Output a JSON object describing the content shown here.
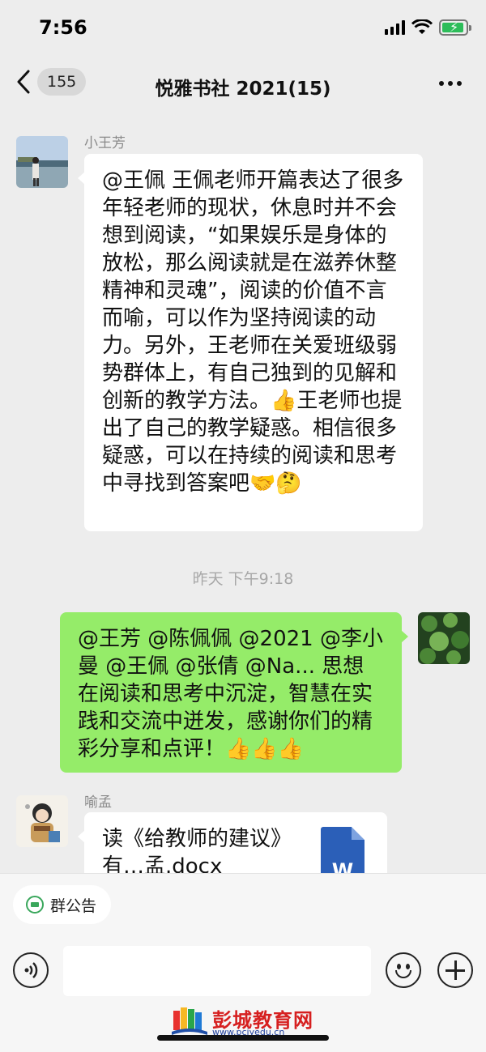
{
  "status_bar": {
    "time": "7:56"
  },
  "nav": {
    "unread_count": "155",
    "title": "悦雅书社 2021(15)"
  },
  "messages": [
    {
      "sender": "小王芳",
      "text": "@王佩 王佩老师开篇表达了很多年轻老师的现状，休息时并不会想到阅读，“如果娱乐是身体的放松，那么阅读就是在滋养休整精神和灵魂”，阅读的价值不言而喻，可以作为坚持阅读的动力。另外，王老师在关爱班级弱势群体上，有自己独到的见解和创新的教学方法。👍王老师也提出了自己的教学疑惑。相信很多疑惑，可以在持续的阅读和思考中寻找到答案吧🤝🤔"
    },
    {
      "timestamp": "昨天 下午9:18"
    },
    {
      "sender": "me",
      "text": "@王芳 @陈佩佩 @2021 @李小曼 @王佩 @张倩 @Na... 思想在阅读和思考中沉淀，智慧在实践和交流中迸发，感谢你们的精彩分享和点评！👍👍👍"
    },
    {
      "sender": "喻孟",
      "file_name": "读《给教师的建议》有…孟.docx",
      "file_icon_letter": "W"
    }
  ],
  "bottom": {
    "announcement_label": "群公告",
    "input_placeholder": ""
  },
  "watermark": {
    "title": "彭城教育网",
    "url": "www.pcjyedu.cn"
  },
  "colors": {
    "outgoing_bubble": "#95ec69",
    "incoming_bubble": "#ffffff",
    "background": "#ededed",
    "word_blue": "#2b5fb8"
  },
  "icons": [
    "back-chevron-icon",
    "more-dots-icon",
    "voice-icon",
    "emoji-icon",
    "plus-icon",
    "announcement-icon",
    "word-file-icon",
    "signal-icon",
    "wifi-icon",
    "battery-icon"
  ]
}
